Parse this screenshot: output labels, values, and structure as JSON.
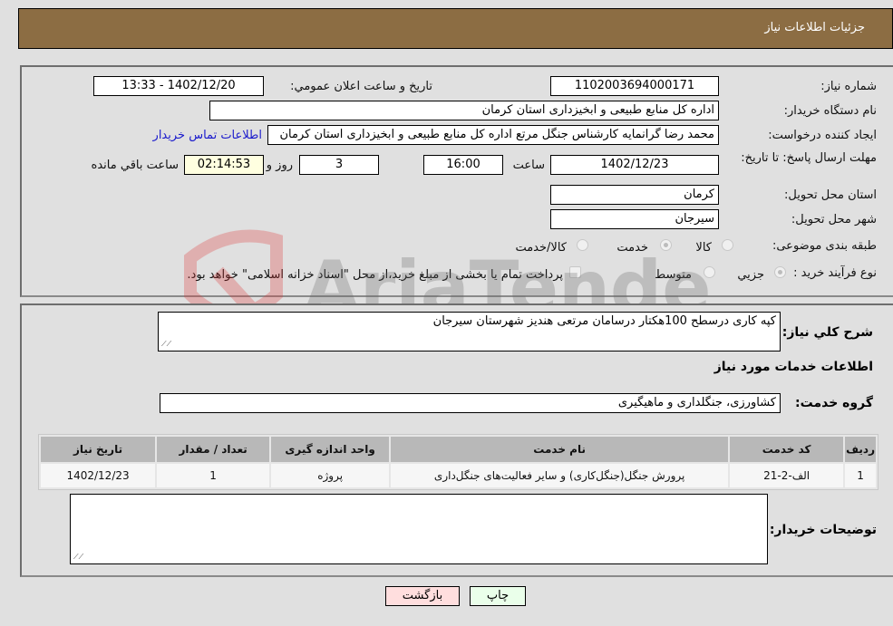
{
  "header": {
    "title": "جزئیات اطلاعات نیاز"
  },
  "form": {
    "need_number_label": "شماره نیاز:",
    "need_number": "1102003694000171",
    "announce_label": "تاریخ و ساعت اعلان عمومي:",
    "announce_value": "1402/12/20 - 13:33",
    "buyer_org_label": "نام دستگاه خریدار:",
    "buyer_org": "اداره کل منابع طبیعی و ابخیزداری استان کرمان",
    "creator_label": "ایجاد کننده درخواست:",
    "creator": "محمد رضا گرانمایه کارشناس جنگل مرتع اداره کل منابع طبیعی و ابخیزداری استان کرمان",
    "buyer_contact_link": "اطلاعات تماس خریدار",
    "deadline_label": "مهلت ارسال پاسخ: تا تاریخ:",
    "deadline_date": "1402/12/23",
    "time_label": "ساعت",
    "deadline_time": "16:00",
    "days_value": "3",
    "days_label": "روز و",
    "remaining_time": "02:14:53",
    "remaining_label": "ساعت باقي مانده",
    "province_label": "استان محل تحویل:",
    "province": "کرمان",
    "city_label": "شهر محل تحویل:",
    "city": "سیرجان",
    "category_label": "طبقه بندی موضوعی:",
    "category_options": [
      {
        "label": "کالا",
        "checked": false
      },
      {
        "label": "خدمت",
        "checked": true
      },
      {
        "label": "کالا/خدمت",
        "checked": false
      }
    ],
    "process_label": "نوع فرآیند خرید :",
    "process_options": [
      {
        "label": "جزيي",
        "checked": true
      },
      {
        "label": "متوسط",
        "checked": false
      }
    ],
    "treasury_note": "پرداخت تمام یا بخشی از مبلغ خرید،از محل \"اسناد خزانه اسلامی\" خواهد بود."
  },
  "details": {
    "description_label": "شرح کلي نياز:",
    "description": "کپه کاری درسطح 100هکتار درسامان مرتعی هندیز شهرستان سیرجان",
    "services_heading": "اطلاعات خدمات مورد نیاز",
    "service_group_label": "گروه خدمت:",
    "service_group": "کشاورزی، جنگلداری و ماهیگیری",
    "table": {
      "headers": [
        "ردیف",
        "کد خدمت",
        "نام خدمت",
        "واحد اندازه گیری",
        "تعداد / مقدار",
        "تاریخ نیاز"
      ],
      "rows": [
        [
          "1",
          "الف-2-21",
          "پرورش جنگل(جنگل‌کاری) و سایر فعالیت‌های جنگل‌داری",
          "پروژه",
          "1",
          "1402/12/23"
        ]
      ]
    },
    "buyer_notes_label": "توضیحات خریدار:",
    "buyer_notes": ""
  },
  "buttons": {
    "print": "چاپ",
    "back": "بازگشت"
  },
  "colors": {
    "header_bg": "#8c6d43",
    "print_bg": "#eaffea",
    "back_bg": "#ffdede",
    "link": "#1a1acc"
  },
  "watermark": {
    "text": "AriaTender.neT"
  }
}
